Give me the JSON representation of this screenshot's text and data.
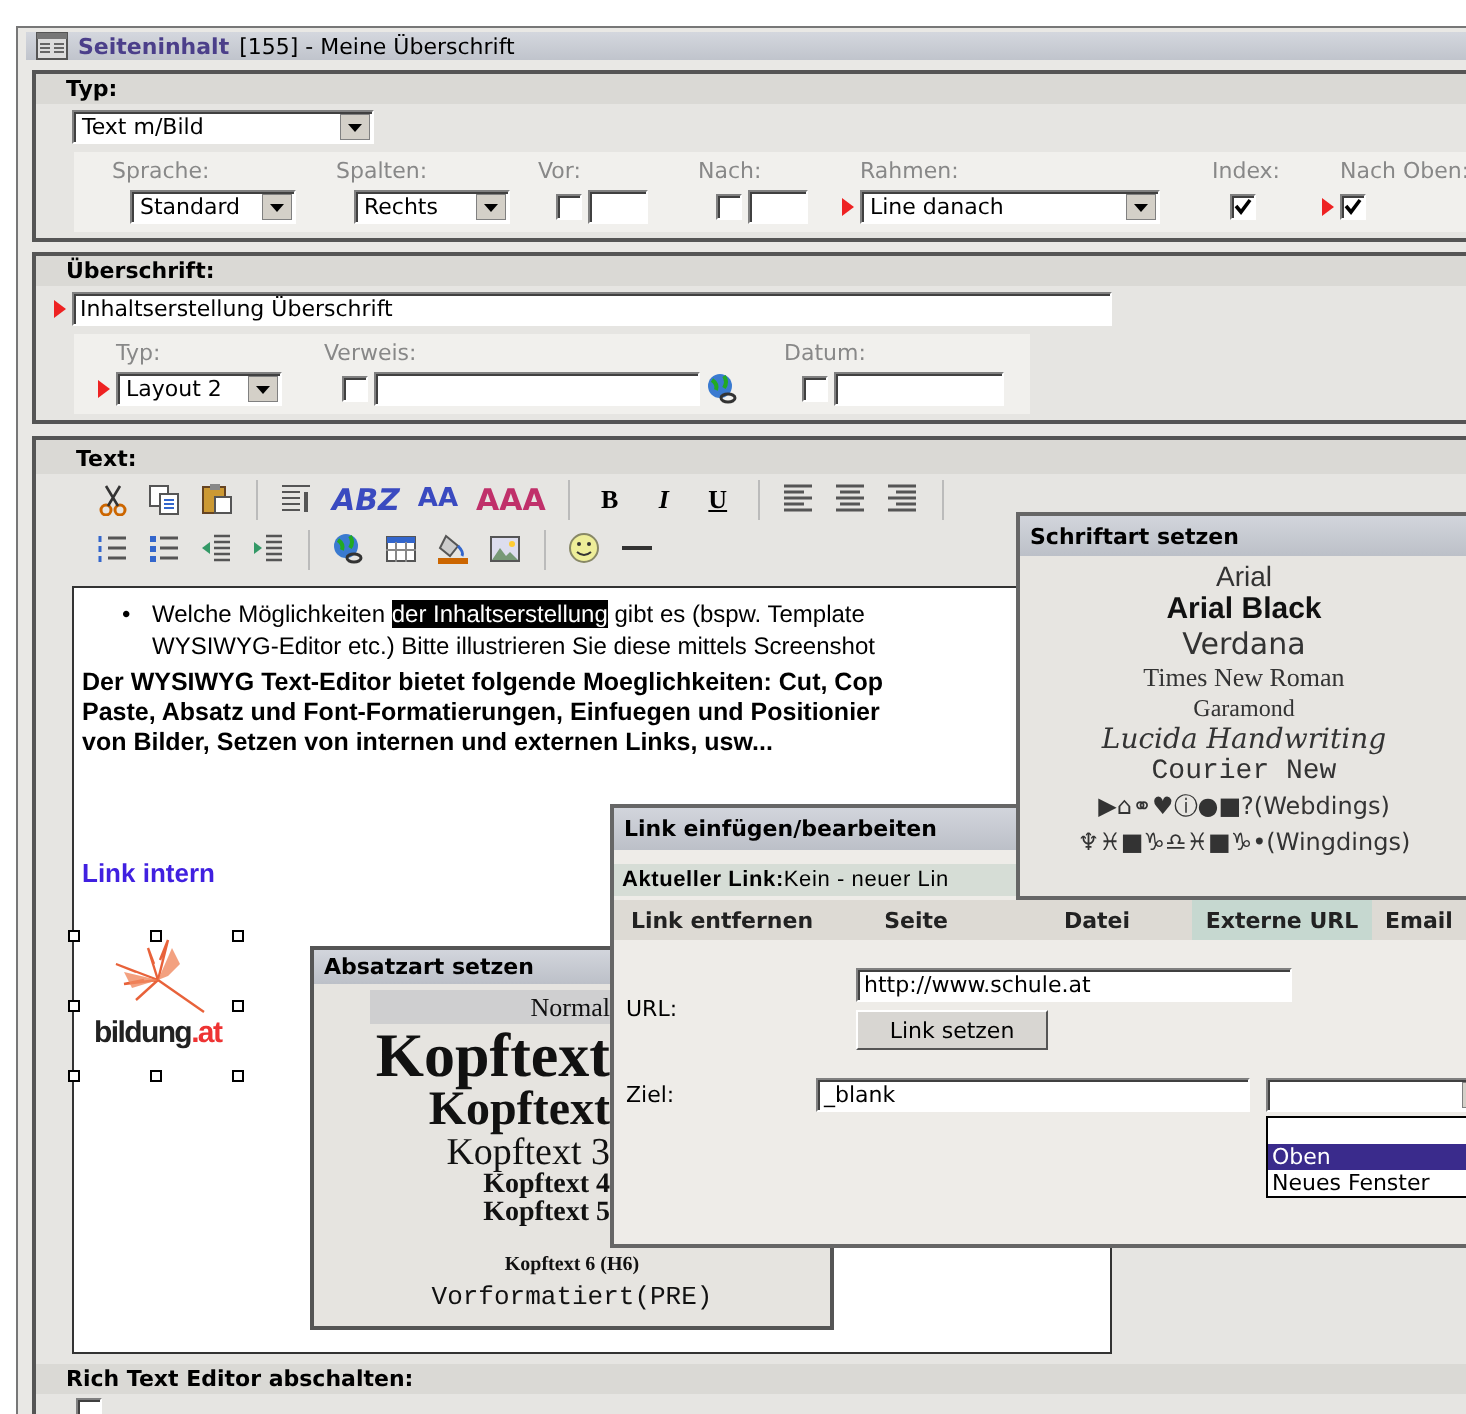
{
  "title": {
    "link": "Seiteninhalt",
    "text": "[155] - Meine Überschrift"
  },
  "typ": {
    "label": "Typ:",
    "value": "Text m/Bild",
    "fields": [
      {
        "kind": "select",
        "label": "Sprache:",
        "value": "Standard",
        "required": false
      },
      {
        "kind": "select",
        "label": "Spalten:",
        "value": "Rechts",
        "required": false
      },
      {
        "kind": "check_number",
        "label": "Vor:",
        "checked": false,
        "required": false
      },
      {
        "kind": "check_number",
        "label": "Nach:",
        "checked": false,
        "required": false
      },
      {
        "kind": "long_select",
        "label": "Rahmen:",
        "value": "Line danach",
        "required": true
      },
      {
        "kind": "check",
        "label": "Index:",
        "checked": true,
        "required": false
      },
      {
        "kind": "check",
        "label": "Nach Oben:",
        "checked": true,
        "required": true
      }
    ]
  },
  "heading": {
    "label": "Überschrift:",
    "value": "Inhaltserstellung Überschrift",
    "required": true,
    "fields": [
      {
        "kind": "select",
        "label": "Typ:",
        "value": "Layout 2",
        "required": true
      },
      {
        "kind": "check_link",
        "label": "Verweis:",
        "checked": false,
        "required": false
      },
      {
        "kind": "check_date",
        "label": "Datum:",
        "checked": false,
        "required": false
      }
    ]
  },
  "text": {
    "label": "Text:",
    "style_buttons": [
      {
        "kind": "face",
        "label": "ABZ"
      },
      {
        "kind": "size",
        "label": "AA"
      },
      {
        "kind": "color",
        "label": "AAA"
      }
    ],
    "format_buttons": [
      "B",
      "I",
      "U"
    ],
    "editor": {
      "bullet": {
        "marker": "•",
        "before": "Welche Möglichkeiten ",
        "highlight": "der Inhaltserstellung",
        "after": " gibt es (bspw. Template",
        "line2": "WYSIWYG-Editor etc.) Bitte illustrieren Sie diese mittels Screenshot"
      },
      "paragraph_lines": [
        "Der WYSIWYG Text-Editor bietet folgende Moeglichkeiten: Cut, Cop",
        "Paste, Absatz und Font-Formatierungen, Einfuegen und Positionier",
        "von Bilder, Setzen von internen und externen Links, usw..."
      ],
      "link": "Link intern",
      "logo": {
        "name": "bildung",
        "suffix": ".at"
      }
    },
    "disable_label": "Rich Text Editor abschalten:",
    "disable_checked": false
  },
  "font_popup": {
    "title": "Schriftart setzen",
    "fonts": [
      {
        "kind": "arial",
        "label": "Arial"
      },
      {
        "kind": "black",
        "label": "Arial Black"
      },
      {
        "kind": "verdana",
        "label": "Verdana"
      },
      {
        "kind": "times",
        "label": "Times New Roman"
      },
      {
        "kind": "garamond",
        "label": "Garamond"
      },
      {
        "kind": "script",
        "label": "Lucida Handwriting"
      },
      {
        "kind": "mono",
        "label": "Courier New"
      },
      {
        "kind": "symbol",
        "label": "▶⌂⚭♥ⓘ●■?(Webdings)"
      },
      {
        "kind": "symbol",
        "label": "♆♓■♑♎♓■♑•(Wingdings)"
      }
    ]
  },
  "link_popup": {
    "title": "Link einfügen/bearbeiten",
    "current_label": "Aktueller Link:",
    "current_value": "Kein - neuer Lin",
    "tabs": [
      {
        "label": "Link entfernen",
        "selected": false
      },
      {
        "label": "Seite",
        "selected": false
      },
      {
        "label": "Datei",
        "selected": false
      },
      {
        "label": "Externe URL",
        "selected": true
      },
      {
        "label": "Email",
        "selected": false
      }
    ],
    "url_label": "URL:",
    "url_value": "http://www.schule.at",
    "set_button": "Link setzen",
    "target_label": "Ziel:",
    "target_value": "_blank",
    "target_options": [
      {
        "label": "Oben",
        "selected": true
      },
      {
        "label": "Neues Fenster",
        "selected": false
      }
    ]
  },
  "paragraph_popup": {
    "title": "Absatzart setzen",
    "styles": [
      {
        "kind": "normal",
        "label": "Normal",
        "selected": true
      },
      {
        "kind": "h1",
        "label": "Kopftext",
        "selected": false
      },
      {
        "kind": "h2",
        "label": "Kopftext",
        "selected": false
      },
      {
        "kind": "h3",
        "label": "Kopftext 3",
        "selected": false
      },
      {
        "kind": "h4",
        "label": "Kopftext 4",
        "selected": false
      },
      {
        "kind": "h5",
        "label": "Kopftext 5",
        "selected": false
      },
      {
        "kind": "h6",
        "label": "Kopftext 6 (H6)",
        "selected": false
      },
      {
        "kind": "pre",
        "label": "Vorformatiert(PRE)",
        "selected": false
      }
    ]
  }
}
